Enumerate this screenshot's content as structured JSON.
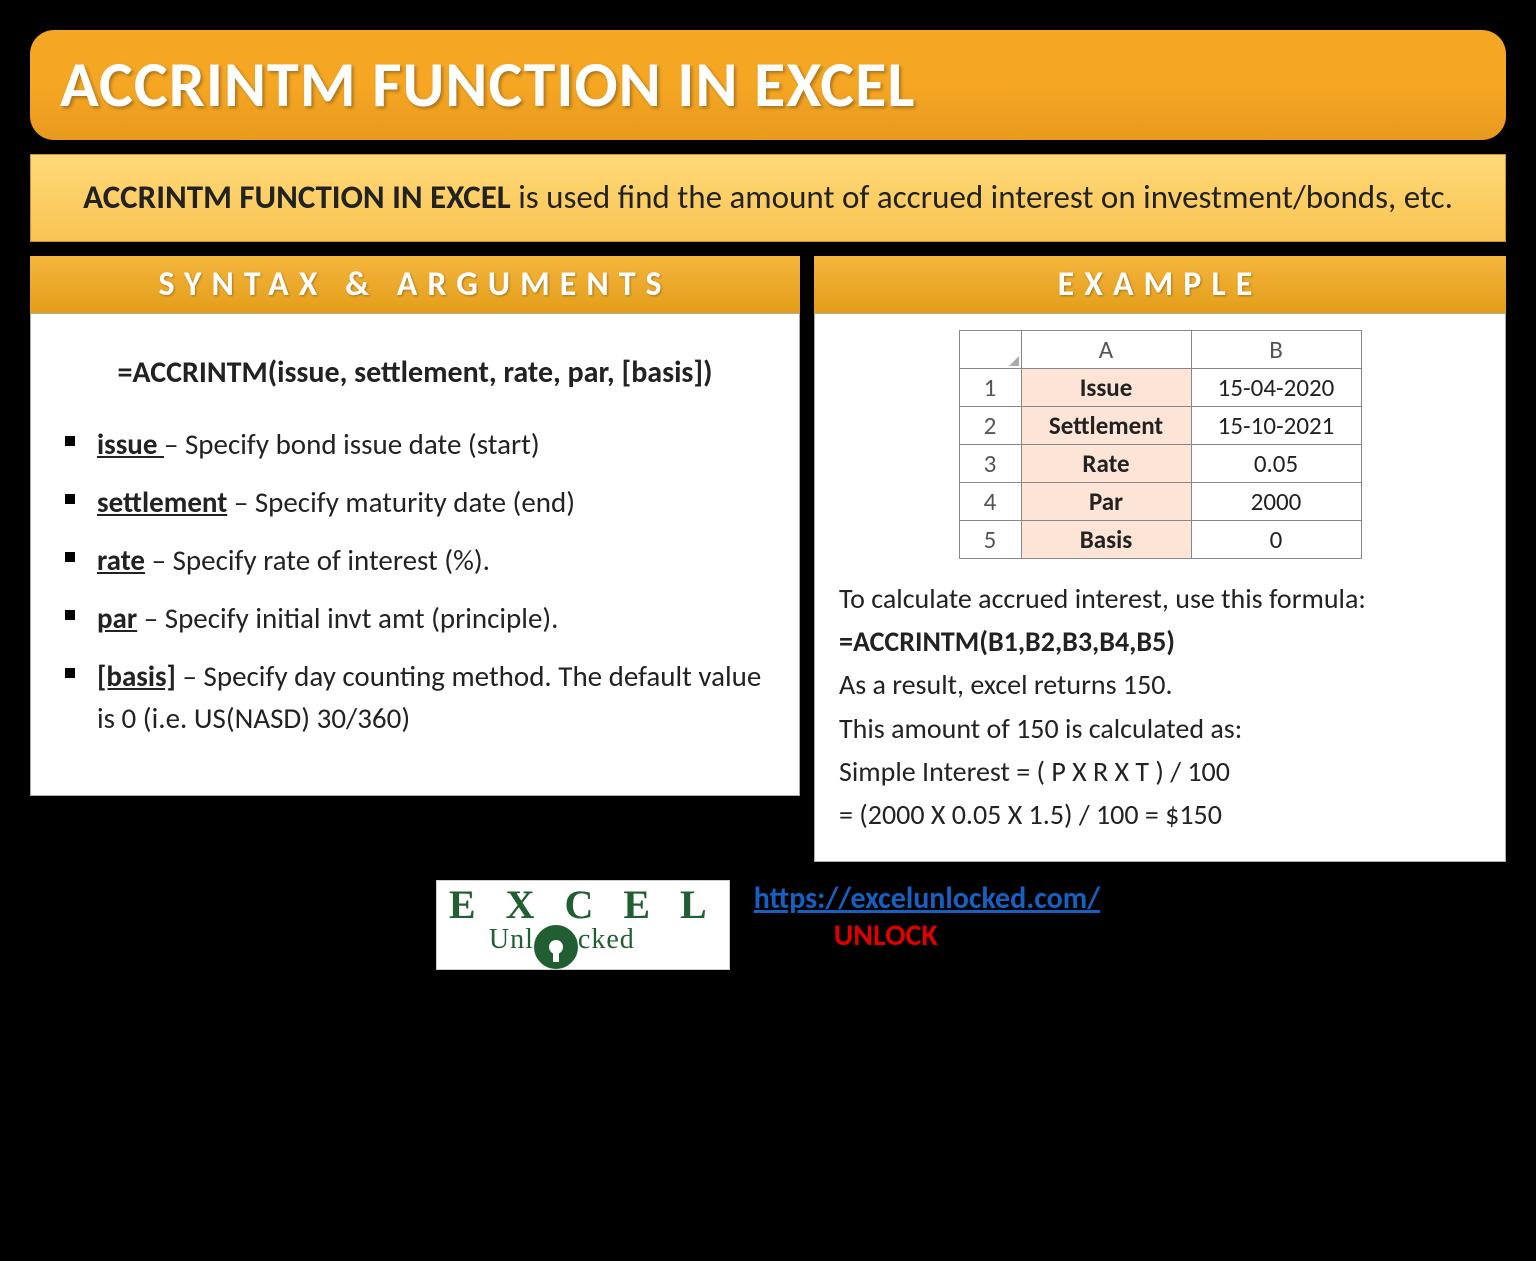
{
  "title": "ACCRINTM FUNCTION IN EXCEL",
  "description": {
    "bold": "ACCRINTM FUNCTION IN EXCEL",
    "rest": " is used find the amount of accrued interest on investment/bonds, etc."
  },
  "syntax": {
    "header": "SYNTAX & ARGUMENTS",
    "formula": "=ACCRINTM(issue, settlement, rate, par, [basis])",
    "args": [
      {
        "name": "issue ",
        "desc": " – Specify bond issue date (start)"
      },
      {
        "name": "settlement",
        "desc": " – Specify maturity date (end)"
      },
      {
        "name": "rate",
        "desc": " – Specify rate of interest (%)."
      },
      {
        "name": "par",
        "desc": " – Specify initial invt amt (principle)."
      },
      {
        "name": "[basis]",
        "desc": " – Specify day counting method. The default value is 0 (i.e. US(NASD) 30/360)"
      }
    ]
  },
  "example": {
    "header": "EXAMPLE",
    "table": {
      "cols": [
        "A",
        "B"
      ],
      "rows": [
        {
          "n": "1",
          "label": "Issue",
          "val": "15-04-2020"
        },
        {
          "n": "2",
          "label": "Settlement",
          "val": "15-10-2021"
        },
        {
          "n": "3",
          "label": "Rate",
          "val": "0.05"
        },
        {
          "n": "4",
          "label": "Par",
          "val": "2000"
        },
        {
          "n": "5",
          "label": "Basis",
          "val": "0"
        }
      ]
    },
    "text1": "To calculate accrued interest, use this formula:",
    "formula": "=ACCRINTM(B1,B2,B3,B4,B5)",
    "text2": "As a result, excel returns 150.",
    "text3": "This amount of 150 is calculated as:",
    "text4": "Simple Interest = ( P X R X T ) / 100",
    "text5": "= (2000 X 0.05 X 1.5) / 100 = $150"
  },
  "footer": {
    "logo1": "EXCEL",
    "logo2": "Unl   cked",
    "link": "https://excelunlocked.com/",
    "unlock": "UNLOCK"
  }
}
